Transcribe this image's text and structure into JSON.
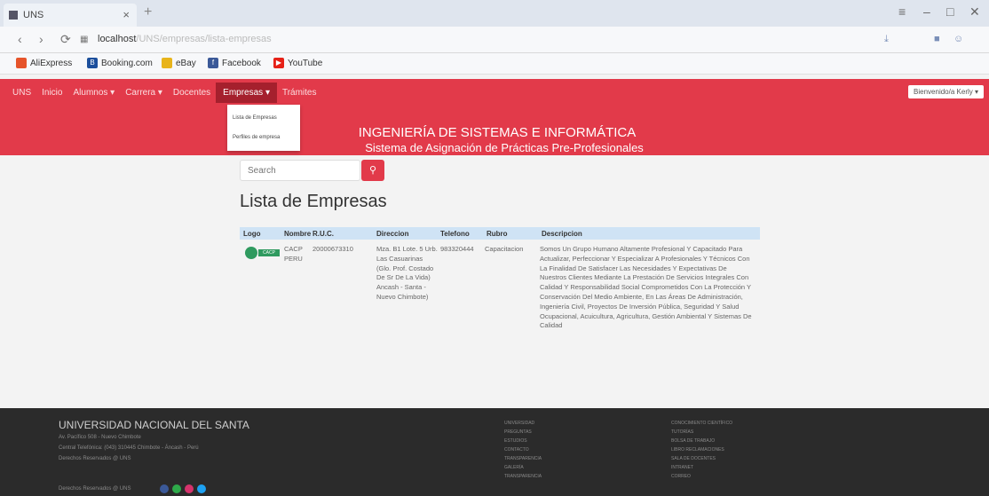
{
  "browser": {
    "tab_title": "UNS",
    "new_tab": "+",
    "url_host": "localhost",
    "url_path": "/UNS/empresas/lista-empresas",
    "bookmarks": [
      "AliExpress",
      "Booking.com",
      "eBay",
      "Facebook",
      "YouTube"
    ],
    "window_controls": [
      "≡",
      "–",
      "□",
      "✕"
    ]
  },
  "site": {
    "nav": [
      "UNS",
      "Inicio",
      "Alumnos ▾",
      "Carrera ▾",
      "Docentes",
      "Empresas ▾",
      "Trámites"
    ],
    "dropdown": [
      "Lista de Empresas",
      "Perfiles de empresa"
    ],
    "user_button": "Bienvenido/a Kerly ▾",
    "title": "INGENIERÍA DE SISTEMAS E INFORMÁTICA",
    "subtitle": "Sistema de Asignación de Prácticas Pre-Profesionales",
    "accent_color": "#e23a4a"
  },
  "main": {
    "search_placeholder": "Search",
    "search_icon": "search-icon",
    "heading": "Lista de Empresas",
    "table": {
      "headers": [
        "Logo",
        "Nombre",
        "R.U.C.",
        "Direccion",
        "Telefono",
        "Rubro",
        "Descripcion"
      ],
      "rows": [
        {
          "logo_text": "CACP",
          "nombre": "CACP PERU",
          "ruc": "20000673310",
          "direccion": "Mza. B1 Lote. 5 Urb. Las Casuarinas (Glo. Prof. Costado De Sr De La Vida) Ancash - Santa - Nuevo Chimbote)",
          "telefono": "983320444",
          "rubro": "Capacitacion",
          "descripcion": "Somos Un Grupo Humano Altamente Profesional Y Capacitado Para Actualizar, Perfeccionar Y Especializar A Profesionales Y Técnicos Con La Finalidad De Satisfacer Las Necesidades Y Expectativas De Nuestros Clientes Mediante La Prestación De Servicios Integrales Con Calidad Y Responsabilidad Social Comprometidos Con La Protección Y Conservación Del Medio Ambiente, En Las Áreas De Administración, Ingeniería Civil, Proyectos De Inversión Pública, Seguridad Y Salud Ocupacional, Acuicultura, Agricultura, Gestión Ambiental Y Sistemas De Calidad"
        }
      ]
    }
  },
  "footer": {
    "title": "UNIVERSIDAD NACIONAL DEL SANTA",
    "lines": [
      "Av. Pacífico 508 - Nuevo Chimbote",
      "Central Telefónica: (043) 310445 Chimbote - Áncash - Perú",
      "Derechos Reservados @ UNS"
    ],
    "copyright": "Derechos Reservados @ UNS",
    "col1": [
      "UNIVERSIDAD",
      "PREGUNTAS",
      "ESTUDIOS",
      "CONTACTO",
      "TRANSPARENCIA",
      "GALERÍA",
      "TRANSPARENCIA"
    ],
    "col2": [
      "CONOCIMIENTO CIENTÍFICO",
      "TUTORÍAS",
      "BOLSA DE TRABAJO",
      "LIBRO RECLAMACIONES",
      "SALA DE DOCENTES",
      "INTRANET",
      "CORREO"
    ]
  }
}
